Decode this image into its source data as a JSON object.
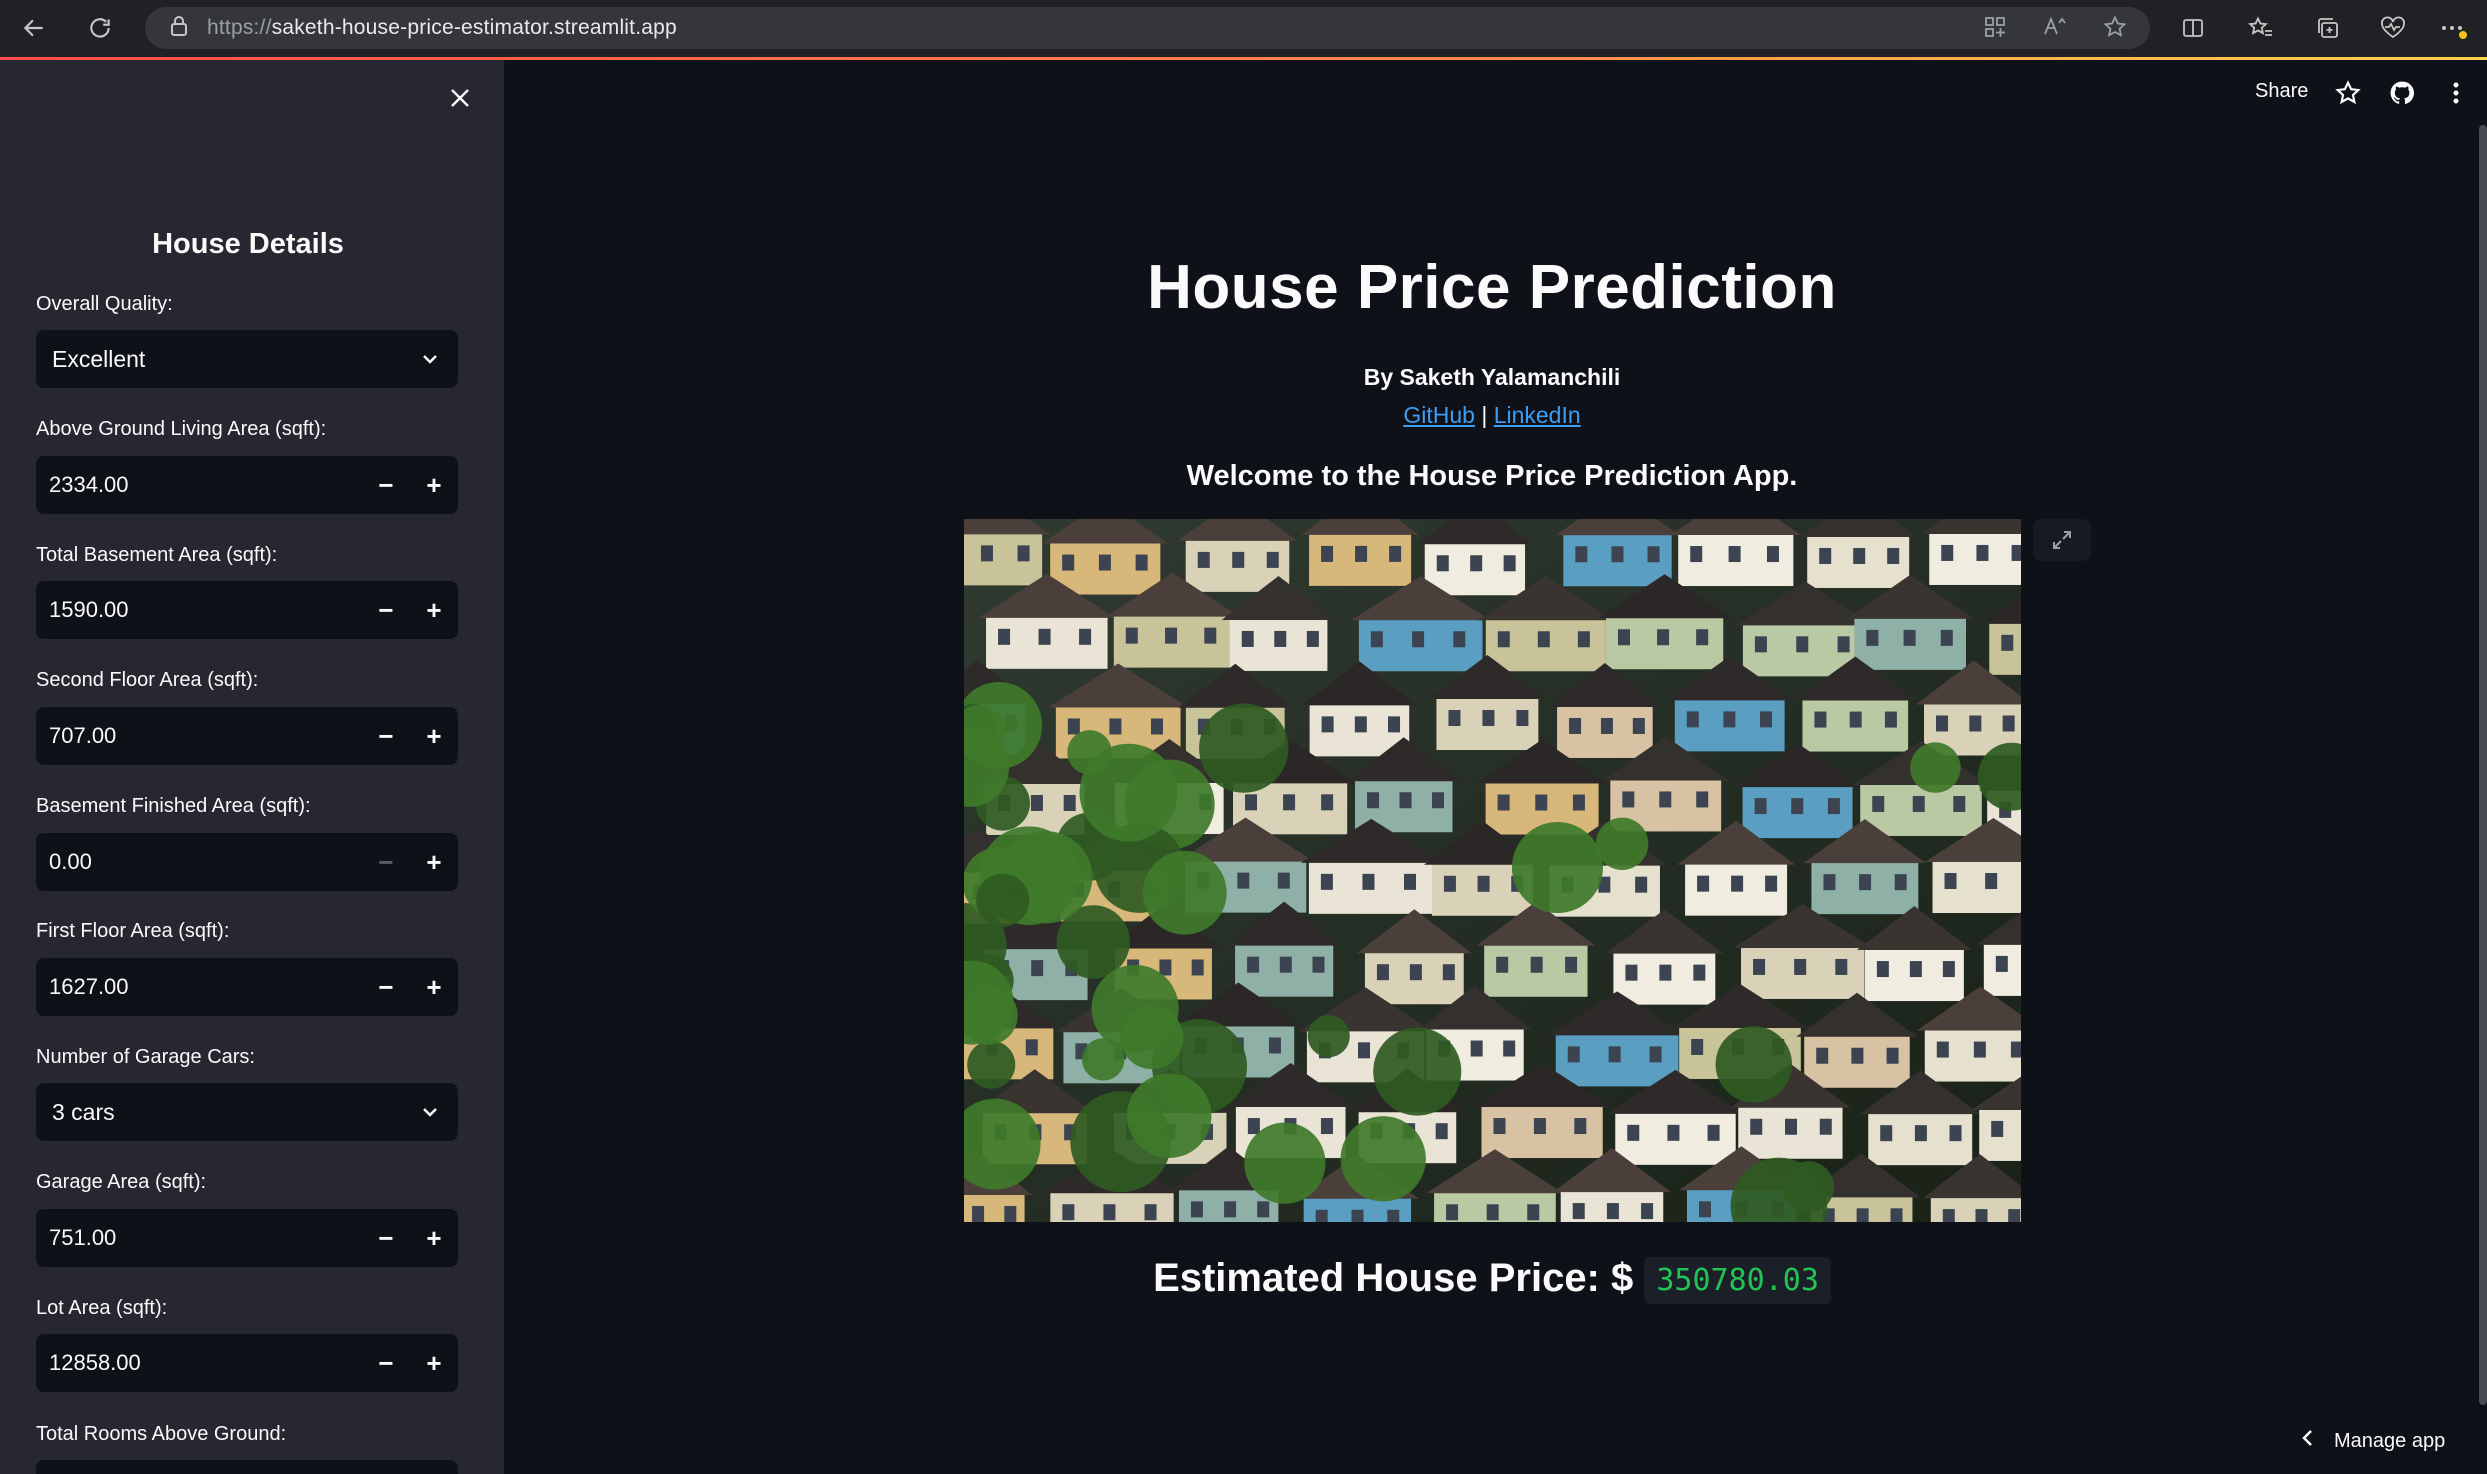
{
  "browser": {
    "url_protocol": "https://",
    "url_host": "saketh-house-price-estimator.streamlit.app"
  },
  "sidebar": {
    "title": "House Details",
    "fields": [
      {
        "label": "Overall Quality:",
        "type": "select",
        "value": "Excellent"
      },
      {
        "label": "Above Ground Living Area (sqft):",
        "type": "number",
        "value": "2334.00"
      },
      {
        "label": "Total Basement Area (sqft):",
        "type": "number",
        "value": "1590.00"
      },
      {
        "label": "Second Floor Area (sqft):",
        "type": "number",
        "value": "707.00"
      },
      {
        "label": "Basement Finished Area (sqft):",
        "type": "number",
        "value": "0.00"
      },
      {
        "label": "First Floor Area (sqft):",
        "type": "number",
        "value": "1627.00"
      },
      {
        "label": "Number of Garage Cars:",
        "type": "select",
        "value": "3 cars"
      },
      {
        "label": "Garage Area (sqft):",
        "type": "number",
        "value": "751.00"
      },
      {
        "label": "Lot Area (sqft):",
        "type": "number",
        "value": "12858.00"
      },
      {
        "label": "Total Rooms Above Ground:",
        "type": "number",
        "value": ""
      }
    ]
  },
  "header": {
    "share_label": "Share"
  },
  "main": {
    "title": "House Price Prediction",
    "byline": "By Saketh Yalamanchili",
    "link_github": "GitHub",
    "link_separator": "|",
    "link_linkedin": "LinkedIn",
    "welcome": "Welcome to the House Price Prediction App.",
    "price_label": "Estimated House Price: $",
    "price_value": "350780.03"
  },
  "footer": {
    "manage_label": "Manage app"
  }
}
